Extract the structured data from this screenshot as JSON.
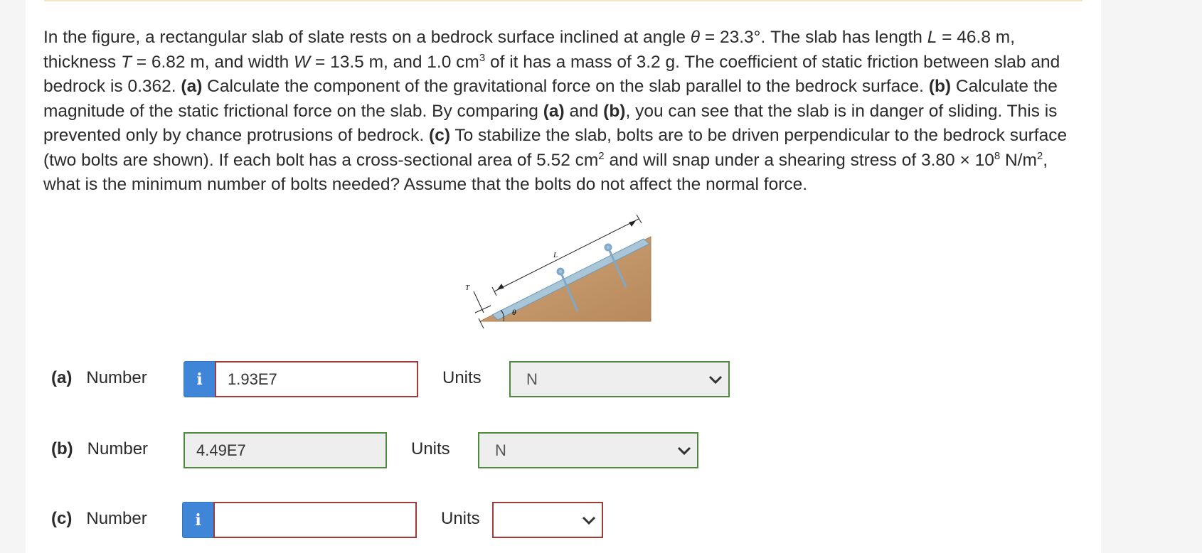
{
  "problem": {
    "t1": "In the figure, a rectangular slab of slate rests on a bedrock surface inclined at angle ",
    "theta_sym": "θ",
    "t2": " = 23.3°. The slab has length ",
    "L_sym": "L",
    "t3": " = 46.8 m, thickness ",
    "T_sym": "T",
    "t4": " = 6.82 m, and width ",
    "W_sym": "W",
    "t5": " = 13.5 m, and 1.0 cm",
    "sup3": "3",
    "t6": " of it has a mass of 3.2 g. The coefficient of static friction between slab and bedrock is 0.362. ",
    "pa": "(a)",
    "t7": " Calculate the component of the gravitational force on the slab parallel to the bedrock surface. ",
    "pb": "(b)",
    "t8": " Calculate the magnitude of the static frictional force on the slab. By comparing ",
    "pa2": "(a)",
    "t9": " and ",
    "pb2": "(b)",
    "t10": ", you can see that the slab is in danger of sliding. This is prevented only by chance protrusions of bedrock. ",
    "pc": "(c)",
    "t11": " To stabilize the slab, bolts are to be driven perpendicular to the bedrock surface (two bolts are shown). If each bolt has a cross-sectional area of 5.52 cm",
    "sup2a": "2",
    "t12": " and will snap under a shearing stress of 3.80 × 10",
    "sup8": "8",
    "t13": " N/m",
    "sup2b": "2",
    "t14": ", what is the minimum number of bolts needed? Assume that the bolts do not affect the normal force."
  },
  "figure": {
    "label_T": "T",
    "label_L": "L",
    "label_theta": "θ"
  },
  "rows": [
    {
      "part": "(a)",
      "label": "Number",
      "value": "1.93E7",
      "units_label": "Units",
      "unit": "N"
    },
    {
      "part": "(b)",
      "label": "Number",
      "value": "4.49E7",
      "units_label": "Units",
      "unit": "N"
    },
    {
      "part": "(c)",
      "label": "Number",
      "value": "",
      "units_label": "Units",
      "unit": ""
    }
  ],
  "icons": {
    "info": "i"
  },
  "colors": {
    "info_blue": "#3f85d8",
    "incorrect_red": "#a33a3a",
    "correct_green": "#4e8a3e"
  }
}
